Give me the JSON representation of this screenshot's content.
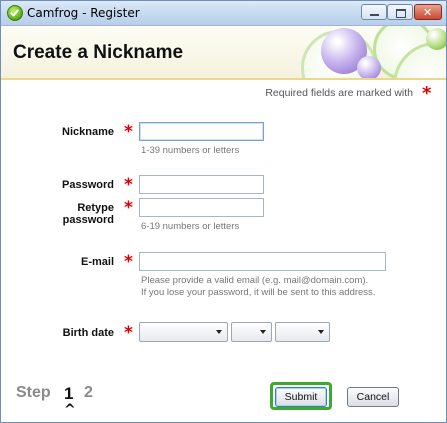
{
  "window": {
    "title": "Camfrog - Register",
    "close_glyph": "✕"
  },
  "header": {
    "title": "Create a Nickname"
  },
  "required_note": "Required fields are marked with",
  "required_mark": "*",
  "form": {
    "nickname": {
      "label": "Nickname",
      "value": "",
      "hint": "1-39 numbers or letters"
    },
    "password": {
      "label": "Password",
      "value": ""
    },
    "retype": {
      "label_line1": "Retype",
      "label_line2": "password",
      "value": "",
      "hint": "6-19 numbers or letters"
    },
    "email": {
      "label": "E-mail",
      "value": "",
      "hint_line1": "Please provide a valid email (e.g. mail@domain.com).",
      "hint_line2": "If you lose your password, it will be sent to this address."
    },
    "birth_date": {
      "label": "Birth date",
      "month": "",
      "day": "",
      "year": ""
    }
  },
  "footer": {
    "step_word": "Step",
    "current_step": "1",
    "next_step": "2",
    "caret": "^",
    "submit_label": "Submit",
    "cancel_label": "Cancel"
  },
  "colors": {
    "accent_green": "#3caa2d",
    "required_red": "#dd0000",
    "header_border": "#e9d98a"
  },
  "icons": [
    "camfrog-app-icon",
    "minimize-icon",
    "maximize-icon",
    "close-icon",
    "chevron-down-icon"
  ]
}
